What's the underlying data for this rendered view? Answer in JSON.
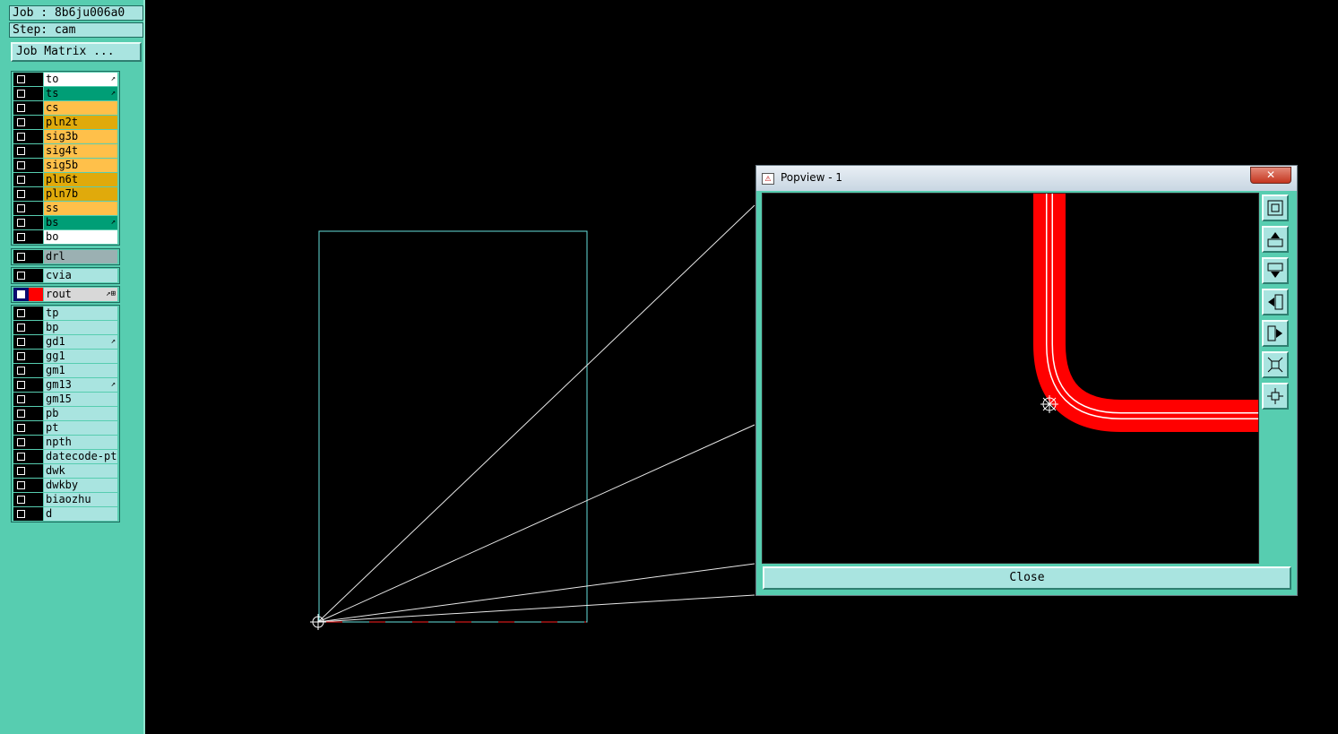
{
  "job": {
    "label": "Job : 8b6ju006a0",
    "step": "Step: cam"
  },
  "job_matrix_button": "Job Matrix ...",
  "layers": {
    "group1": [
      {
        "name": "to",
        "color": "#ffffff",
        "tag": "↗"
      },
      {
        "name": "ts",
        "color": "#009e76",
        "tag": "↗"
      },
      {
        "name": "cs",
        "color": "#ffc04a",
        "tag": ""
      },
      {
        "name": "pln2t",
        "color": "#e0aa0b",
        "tag": ""
      },
      {
        "name": "sig3b",
        "color": "#ffc04a",
        "tag": ""
      },
      {
        "name": "sig4t",
        "color": "#ffc04a",
        "tag": ""
      },
      {
        "name": "sig5b",
        "color": "#ffc04a",
        "tag": ""
      },
      {
        "name": "pln6t",
        "color": "#e0aa0b",
        "tag": ""
      },
      {
        "name": "pln7b",
        "color": "#e0aa0b",
        "tag": ""
      },
      {
        "name": "ss",
        "color": "#ffc04a",
        "tag": ""
      },
      {
        "name": "bs",
        "color": "#009e76",
        "tag": "↗"
      },
      {
        "name": "bo",
        "color": "#ffffff",
        "tag": ""
      }
    ],
    "group2": [
      {
        "name": "drl",
        "color": "#9bb0b2",
        "tag": ""
      }
    ],
    "group3": [
      {
        "name": "cvia",
        "color": "#a9e4e0",
        "tag": ""
      }
    ],
    "group4": [
      {
        "name": "rout",
        "color": "#d8d8d8",
        "tag": "↗⊞",
        "active": true,
        "swatch": "#ff0000"
      }
    ],
    "group5": [
      {
        "name": "tp",
        "color": "#a9e4e0",
        "tag": ""
      },
      {
        "name": "bp",
        "color": "#a9e4e0",
        "tag": ""
      },
      {
        "name": "gd1",
        "color": "#a9e4e0",
        "tag": "↗"
      },
      {
        "name": "gg1",
        "color": "#a9e4e0",
        "tag": ""
      },
      {
        "name": "gm1",
        "color": "#a9e4e0",
        "tag": ""
      },
      {
        "name": "gm13",
        "color": "#a9e4e0",
        "tag": "↗"
      },
      {
        "name": "gm15",
        "color": "#a9e4e0",
        "tag": ""
      },
      {
        "name": "pb",
        "color": "#a9e4e0",
        "tag": ""
      },
      {
        "name": "pt",
        "color": "#a9e4e0",
        "tag": ""
      },
      {
        "name": "npth",
        "color": "#a9e4e0",
        "tag": ""
      },
      {
        "name": "datecode-ptc",
        "color": "#a9e4e0",
        "tag": ""
      },
      {
        "name": "dwk",
        "color": "#a9e4e0",
        "tag": ""
      },
      {
        "name": "dwkby",
        "color": "#a9e4e0",
        "tag": ""
      },
      {
        "name": "biaozhu",
        "color": "#a9e4e0",
        "tag": ""
      },
      {
        "name": "d",
        "color": "#a9e4e0",
        "tag": ""
      }
    ]
  },
  "popview": {
    "title": "Popview - 1",
    "close_x": "✕",
    "close_button": "Close",
    "tools": [
      "zoom-home",
      "pan-up",
      "pan-down",
      "pan-left",
      "pan-right",
      "zoom-in",
      "zoom-out"
    ]
  },
  "colors": {
    "panel": "#57cdb0",
    "route": "#ff0000",
    "outline": "#66e0dc"
  }
}
